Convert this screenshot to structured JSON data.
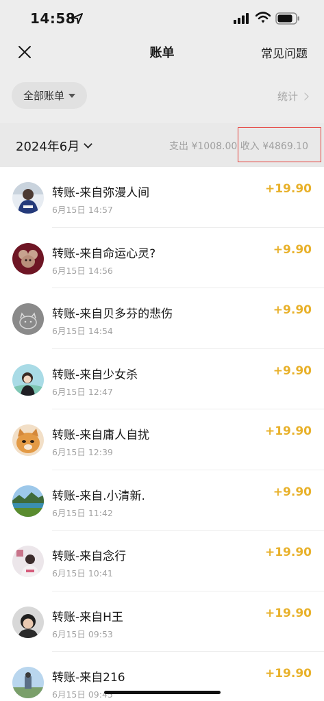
{
  "status_bar": {
    "time": "14:58"
  },
  "nav": {
    "title": "账单",
    "faq_label": "常见问题"
  },
  "filter": {
    "label": "全部账单",
    "stats_label": "统计"
  },
  "month_bar": {
    "month": "2024年6月",
    "summary": "支出 ¥1008.00 收入 ¥4869.10"
  },
  "transactions": [
    {
      "title": "转账-来自弥漫人间",
      "date": "6月15日 14:57",
      "amount": "+19.90"
    },
    {
      "title": "转账-来自命运心灵?",
      "date": "6月15日 14:56",
      "amount": "+9.90"
    },
    {
      "title": "转账-来自贝多芬的悲伤",
      "date": "6月15日 14:54",
      "amount": "+9.90"
    },
    {
      "title": "转账-来自少女杀",
      "date": "6月15日 12:47",
      "amount": "+9.90"
    },
    {
      "title": "转账-来自庸人自扰",
      "date": "6月15日 12:39",
      "amount": "+19.90"
    },
    {
      "title": "转账-来自.小清新.",
      "date": "6月15日 11:42",
      "amount": "+9.90"
    },
    {
      "title": "转账-来自念行",
      "date": "6月15日 10:41",
      "amount": "+19.90"
    },
    {
      "title": "转账-来自H王",
      "date": "6月15日 09:53",
      "amount": "+19.90"
    },
    {
      "title": "转账-来自216",
      "date": "6月15日 09:45",
      "amount": "+19.90"
    }
  ],
  "colors": {
    "income": "#e8b12b",
    "highlight_box": "#e53935",
    "header_bg": "#ededed"
  }
}
